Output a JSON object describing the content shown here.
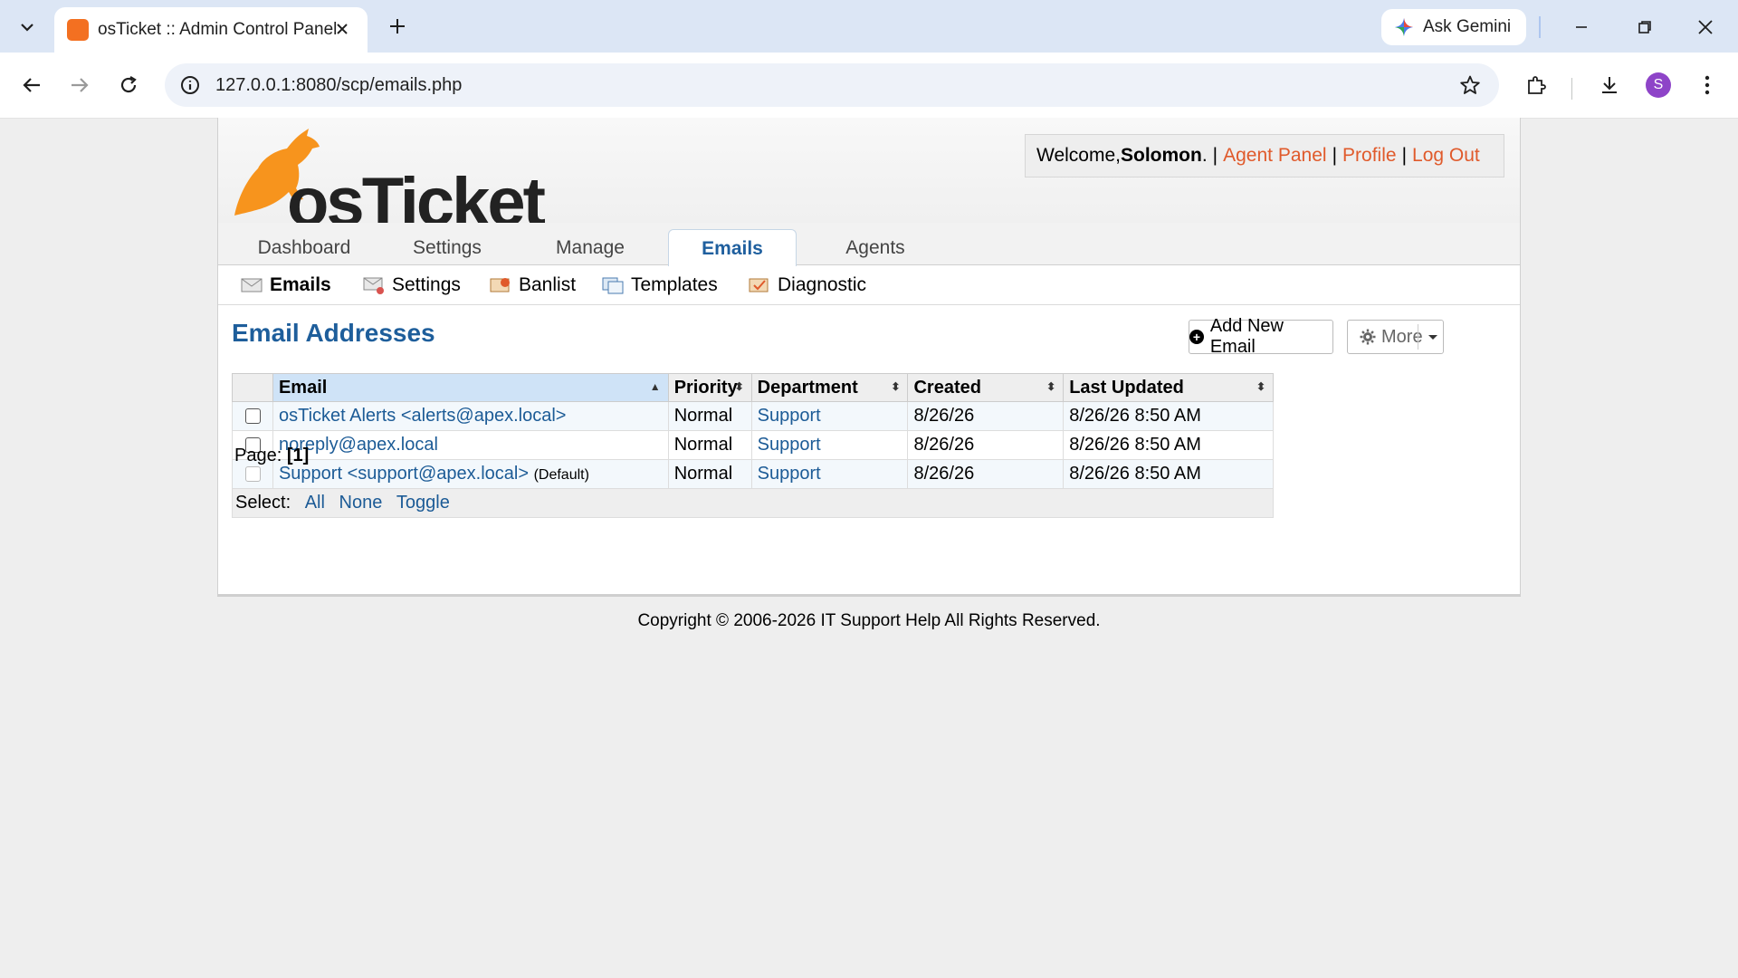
{
  "browser": {
    "tab_title": "osTicket :: Admin Control Panel",
    "url": "127.0.0.1:8080/scp/emails.php",
    "gemini_label": "Ask Gemini",
    "profile_initial": "S"
  },
  "header": {
    "logo_text": "osTicket",
    "welcome_prefix": "Welcome, ",
    "user_name": "Solomon",
    "welcome_suffix": ".",
    "agent_panel": "Agent Panel",
    "profile": "Profile",
    "logout": "Log Out",
    "sep": "|"
  },
  "nav": {
    "tabs": [
      {
        "label": "Dashboard"
      },
      {
        "label": "Settings"
      },
      {
        "label": "Manage"
      },
      {
        "label": "Emails"
      },
      {
        "label": "Agents"
      }
    ]
  },
  "subnav": {
    "items": [
      {
        "label": "Emails"
      },
      {
        "label": "Settings"
      },
      {
        "label": "Banlist"
      },
      {
        "label": "Templates"
      },
      {
        "label": "Diagnostic"
      }
    ]
  },
  "main": {
    "title": "Email Addresses",
    "add_button": "Add New Email",
    "more_button": "More",
    "columns": [
      "Email",
      "Priority",
      "Department",
      "Created",
      "Last Updated"
    ],
    "rows": [
      {
        "email": "osTicket Alerts <alerts@apex.local>",
        "default": "",
        "priority": "Normal",
        "department": "Support",
        "created": "8/26/26",
        "updated": "8/26/26 8:50 AM"
      },
      {
        "email": "noreply@apex.local",
        "default": "",
        "priority": "Normal",
        "department": "Support",
        "created": "8/26/26",
        "updated": "8/26/26 8:50 AM"
      },
      {
        "email": "Support <support@apex.local>",
        "default": "(Default)",
        "priority": "Normal",
        "department": "Support",
        "created": "8/26/26",
        "updated": "8/26/26 8:50 AM"
      }
    ],
    "select_label": "Select:",
    "select_all": "All",
    "select_none": "None",
    "select_toggle": "Toggle",
    "page_label": "Page:",
    "page_current": "[1]"
  },
  "footer": {
    "copyright": "Copyright © 2006-2026 IT Support Help All Rights Reserved."
  },
  "colors": {
    "accent_link": "#1c5b96",
    "header_link": "#e05a2b",
    "logo_orange": "#f7941d"
  }
}
